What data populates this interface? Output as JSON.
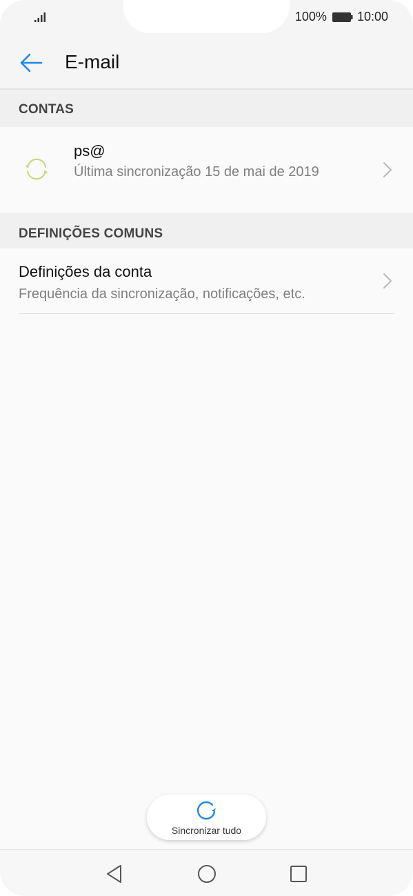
{
  "status_bar": {
    "battery_percent": "100%",
    "time": "10:00",
    "icons": [
      "signal-icon",
      "battery-icon"
    ]
  },
  "app_bar": {
    "title": "E-mail",
    "back_icon": "arrow-left-icon"
  },
  "sections": {
    "accounts_header": "CONTAS",
    "common_header": "DEFINIÇÕES COMUNS"
  },
  "account": {
    "name": "ps@",
    "last_sync": "Última sincronização 15 de mai de 2019",
    "icon": "sync-icon"
  },
  "account_settings": {
    "title": "Definições da conta",
    "subtitle": "Frequência da sincronização, notificações, etc."
  },
  "sync_all": {
    "label": "Sincronizar tudo",
    "icon": "refresh-icon"
  },
  "nav": {
    "icons": [
      "nav-back-icon",
      "nav-home-icon",
      "nav-recent-icon"
    ]
  },
  "colors": {
    "accent": "#1e88e5",
    "account_icon": "#c6dc82",
    "text_secondary": "#808080"
  }
}
